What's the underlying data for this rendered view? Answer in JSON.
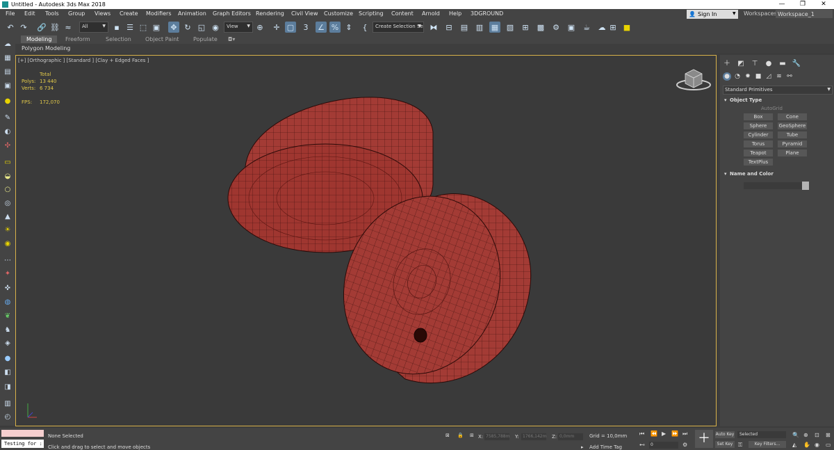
{
  "window": {
    "title": "Untitled - Autodesk 3ds Max 2018",
    "min": "—",
    "max": "❐",
    "close": "✕"
  },
  "menus": [
    "File",
    "Edit",
    "Tools",
    "Group",
    "Views",
    "Create",
    "Modifiers",
    "Animation",
    "Graph Editors",
    "Rendering",
    "Civil View",
    "Customize",
    "Scripting",
    "Content",
    "Arnold",
    "Help",
    "3DGROUND"
  ],
  "account": {
    "signin": "Sign In",
    "workspaces_label": "Workspaces:",
    "workspace": "Workspace_1"
  },
  "toolbar": {
    "selection_filter": "All",
    "ref_coord": "View",
    "angle_snap": "3",
    "named_selection": "Create Selection Se"
  },
  "ribbon": {
    "tabs": [
      "Modeling",
      "Freeform",
      "Selection",
      "Object Paint",
      "Populate"
    ],
    "sub": "Polygon Modeling"
  },
  "viewport": {
    "label": "[+] [Orthographic ] [Standard ] [Clay + Edged Faces ]",
    "stats": {
      "total_label": "Total",
      "polys_label": "Polys:",
      "polys": "13 440",
      "verts_label": "Verts:",
      "verts": "6 734",
      "fps_label": "FPS:",
      "fps": "172,070"
    }
  },
  "command_panel": {
    "category": "Standard Primitives",
    "object_type": "Object Type",
    "autogrid": "AutoGrid",
    "buttons": [
      "Box",
      "Cone",
      "Sphere",
      "GeoSphere",
      "Cylinder",
      "Tube",
      "Torus",
      "Pyramid",
      "Teapot",
      "Plane",
      "TextPlus"
    ],
    "name_color": "Name and Color"
  },
  "status": {
    "maxscript": "Testing for :",
    "selection": "None Selected",
    "prompt": "Click and drag to select and move objects",
    "x_label": "X:",
    "x": "7585,788m",
    "y_label": "Y:",
    "y": "1766,142m",
    "z_label": "Z:",
    "z": "0,0mm",
    "grid": "Grid = 10,0mm",
    "add_time_tag": "Add Time Tag",
    "auto_key": "Auto Key",
    "set_key": "Set Key",
    "key_mode": "Selected",
    "key_filters": "Key Filters...",
    "frame": "0"
  },
  "colors": {
    "accent": "#5c7d9c",
    "viewport_border": "#d8b24a",
    "mesh": "#a33b35",
    "stats": "#e2c94a"
  }
}
